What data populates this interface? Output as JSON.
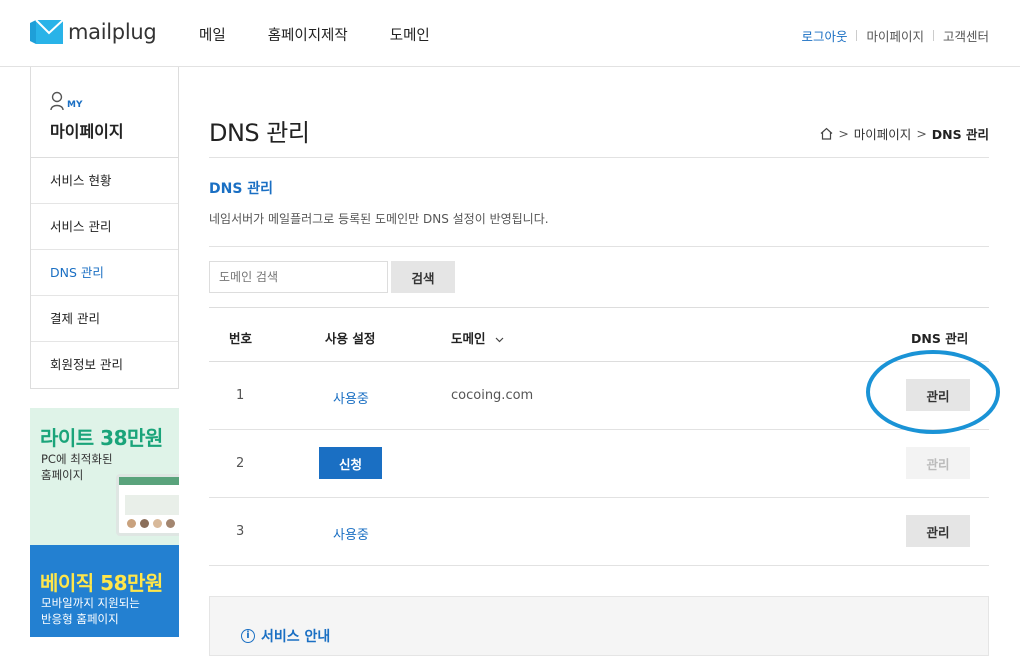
{
  "header": {
    "logo_text": "mailplug",
    "nav": [
      "메일",
      "홈페이지제작",
      "도메인"
    ],
    "util": {
      "logout": "로그아웃",
      "mypage": "마이페이지",
      "support": "고객센터"
    }
  },
  "sidebar": {
    "badge": "MY",
    "title": "마이페이지",
    "items": [
      {
        "label": "서비스 현황"
      },
      {
        "label": "서비스 관리"
      },
      {
        "label": "DNS 관리"
      },
      {
        "label": "결제 관리"
      },
      {
        "label": "회원정보 관리"
      }
    ]
  },
  "banners": [
    {
      "title": "라이트 38만원",
      "sub1": "PC에 최적화된",
      "sub2": "홈페이지"
    },
    {
      "title": "베이직 58만원",
      "sub1": "모바일까지 지원되는",
      "sub2": "반응형 홈페이지"
    }
  ],
  "main": {
    "page_title": "DNS 관리",
    "breadcrumb": {
      "parent": "마이페이지",
      "current": "DNS 관리"
    },
    "section_title": "DNS 관리",
    "section_desc": "네임서버가 메일플러그로 등록된 도메인만 DNS 설정이 반영됩니다.",
    "search": {
      "placeholder": "도메인 검색",
      "button": "검색"
    },
    "table": {
      "headers": {
        "no": "번호",
        "usage": "사용 설정",
        "domain": "도메인",
        "dns": "DNS 관리"
      },
      "rows": [
        {
          "no": "1",
          "status": "사용중",
          "domain": "cocoing.com",
          "action": "관리"
        },
        {
          "no": "2",
          "status": "신청",
          "domain": "",
          "action": "관리"
        },
        {
          "no": "3",
          "status": "사용중",
          "domain": "",
          "action": "관리"
        }
      ]
    },
    "info": {
      "title": "서비스 안내"
    }
  },
  "colors": {
    "accent": "#1a6fc3",
    "highlight": "#1a93d6",
    "banner_green": "#1aa47a",
    "banner_blue": "#2380d1"
  }
}
